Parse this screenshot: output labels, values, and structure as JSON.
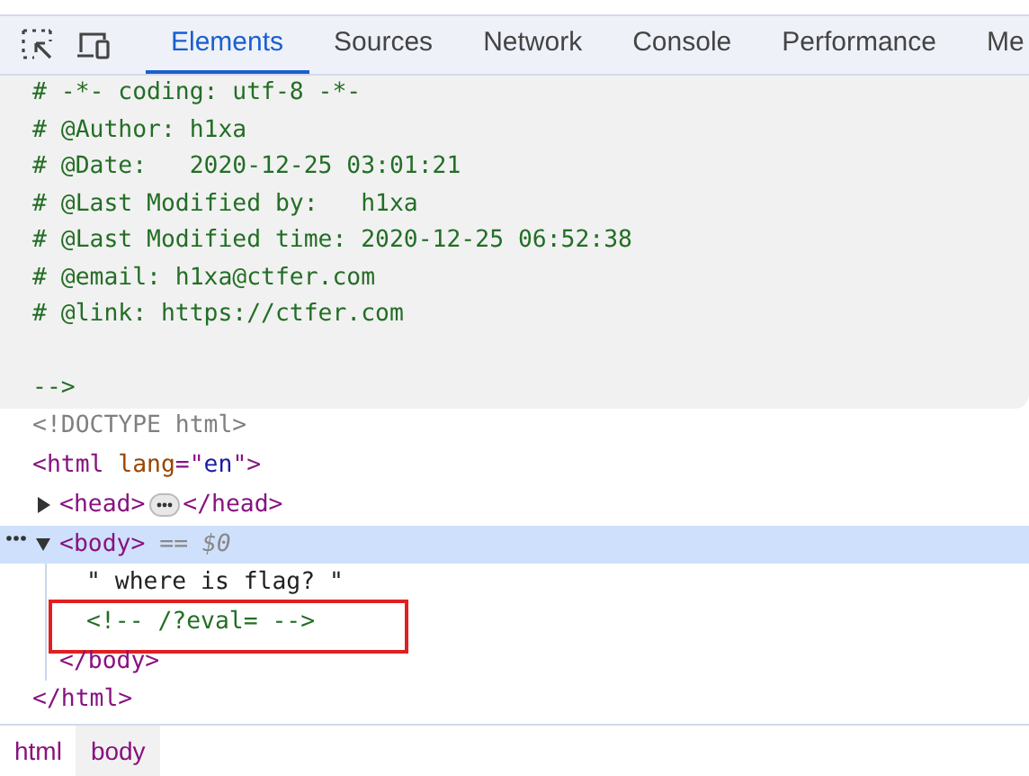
{
  "toolbar": {
    "tabs": [
      {
        "label": "Elements",
        "selected": true
      },
      {
        "label": "Sources",
        "selected": false
      },
      {
        "label": "Network",
        "selected": false
      },
      {
        "label": "Console",
        "selected": false
      },
      {
        "label": "Performance",
        "selected": false
      },
      {
        "label": "Me",
        "selected": false
      }
    ]
  },
  "comment_block": {
    "lines": [
      "# -*- coding: utf-8 -*-",
      "# @Author: h1xa",
      "# @Date:   2020-12-25 03:01:21",
      "# @Last Modified by:   h1xa",
      "# @Last Modified time: 2020-12-25 06:52:38",
      "# @email: h1xa@ctfer.com",
      "# @link: https://ctfer.com"
    ],
    "closing": "-->"
  },
  "tree": [
    {
      "kind": "doctype",
      "text": "<!DOCTYPE html>"
    },
    {
      "kind": "element",
      "open": "<html lang=\"en\">",
      "close": "</html>",
      "children": [
        {
          "kind": "element",
          "open": "<head>",
          "close": "</head>",
          "expanded": false,
          "selected": false
        },
        {
          "kind": "element",
          "open": "<body>",
          "close": "</body>",
          "expanded": true,
          "selected": true,
          "badge": "== $0",
          "children": [
            {
              "kind": "text",
              "text": "\" where is flag? \""
            },
            {
              "kind": "comment",
              "text": "<!-- /?eval= -->",
              "highlighted": true
            }
          ]
        }
      ]
    }
  ],
  "breadcrumbs": [
    {
      "label": "html",
      "selected": false
    },
    {
      "label": "body",
      "selected": true
    }
  ]
}
